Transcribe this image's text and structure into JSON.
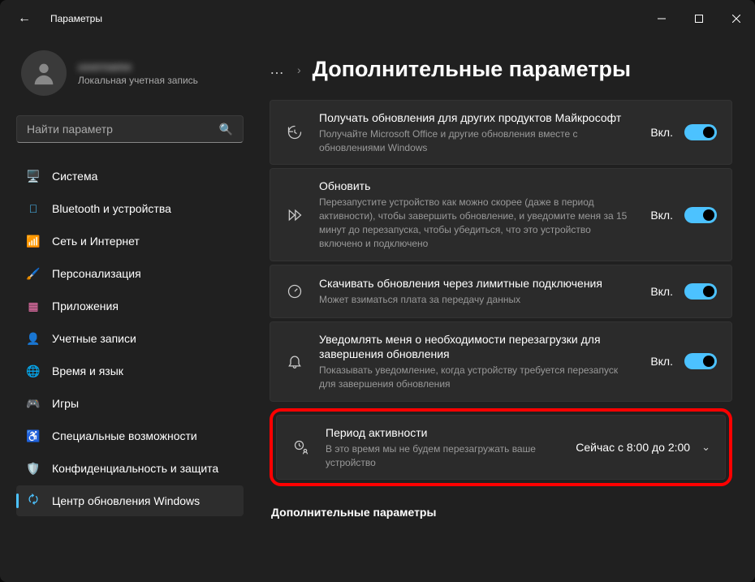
{
  "window": {
    "title": "Параметры"
  },
  "user": {
    "name": "username",
    "subtitle": "Локальная учетная запись"
  },
  "search": {
    "placeholder": "Найти параметр"
  },
  "sidebar": {
    "items": [
      {
        "label": "Система"
      },
      {
        "label": "Bluetooth и устройства"
      },
      {
        "label": "Сеть и Интернет"
      },
      {
        "label": "Персонализация"
      },
      {
        "label": "Приложения"
      },
      {
        "label": "Учетные записи"
      },
      {
        "label": "Время и язык"
      },
      {
        "label": "Игры"
      },
      {
        "label": "Специальные возможности"
      },
      {
        "label": "Конфиденциальность и защита"
      },
      {
        "label": "Центр обновления Windows"
      }
    ]
  },
  "page": {
    "title": "Дополнительные параметры"
  },
  "toggle_on_label": "Вкл.",
  "cards": {
    "other_products": {
      "title": "Получать обновления для других продуктов Майкрософт",
      "desc": "Получайте Microsoft Office и другие обновления вместе с обновлениями Windows"
    },
    "refresh": {
      "title": "Обновить",
      "desc": "Перезапустите устройство как можно скорее (даже в период активности), чтобы завершить обновление, и уведомите меня за 15 минут до перезапуска, чтобы убедиться, что это устройство включено и подключено"
    },
    "metered": {
      "title": "Скачивать обновления через лимитные подключения",
      "desc": "Может взиматься плата за передачу данных"
    },
    "notify": {
      "title": "Уведомлять меня о необходимости перезагрузки для завершения обновления",
      "desc": "Показывать уведомление, когда устройству требуется перезапуск для завершения обновления"
    },
    "active_hours": {
      "title": "Период активности",
      "desc": "В это время мы не будем перезагружать ваше устройство",
      "value": "Сейчас с 8:00 до 2:00"
    }
  },
  "section2": "Дополнительные параметры"
}
